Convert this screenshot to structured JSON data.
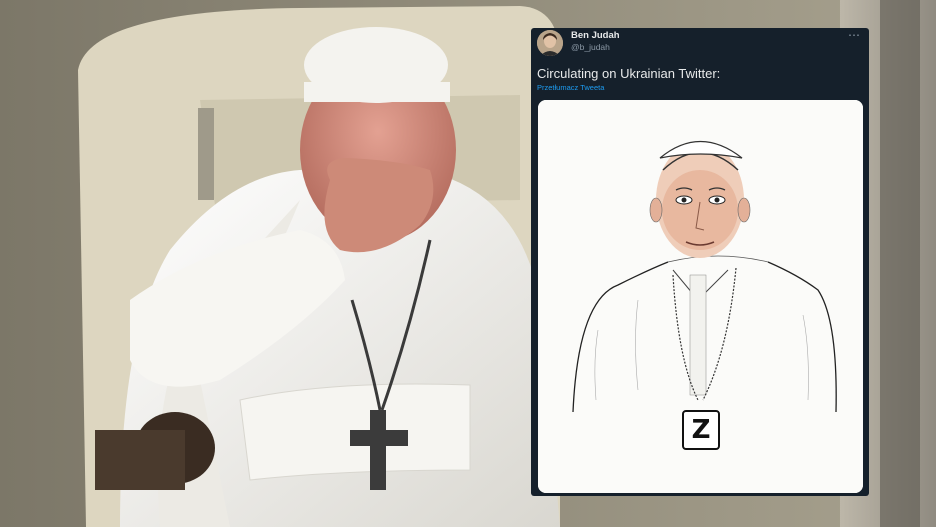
{
  "tweet": {
    "author_name": "Ben Judah",
    "author_handle": "@b_judah",
    "more_icon": "⋯",
    "text": "Circulating on Ukrainian Twitter:",
    "translate_link": "Przetłumacz Tweeta"
  },
  "drawing": {
    "pendant_letter": "Z"
  },
  "colors": {
    "tweet_background": "#15202b",
    "link": "#1d9bf0",
    "papal_white": "#f4f3ef"
  }
}
